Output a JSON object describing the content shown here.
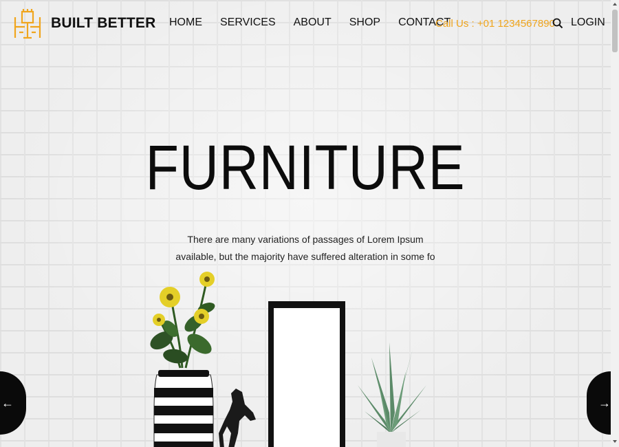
{
  "header": {
    "brand": "BUILT BETTER",
    "nav": [
      "HOME",
      "SERVICES",
      "ABOUT",
      "SHOP",
      "CONTACT"
    ],
    "phone": "Call Us : +01 1234567890",
    "login": "LOGIN",
    "accent_color": "#f0a51c",
    "icons": [
      "logo-icon",
      "search-icon"
    ]
  },
  "hero": {
    "title": "FURNITURE",
    "description": "There are many variations of passages of Lorem Ipsum available, but the majority have suffered alteration in some fo"
  },
  "slider": {
    "prev_icon": "arrow-left-icon",
    "next_icon": "arrow-right-icon",
    "prev_glyph": "←",
    "next_glyph": "→"
  }
}
